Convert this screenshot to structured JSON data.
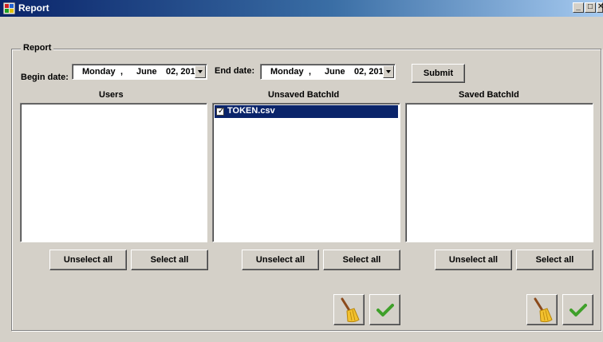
{
  "window": {
    "title": "Report",
    "minimize_glyph": "_",
    "restore_glyph": "□",
    "close_glyph": "✕"
  },
  "group": {
    "title": "Report"
  },
  "filters": {
    "begin_label": "Begin date:",
    "begin": {
      "day": "Monday",
      "sep": ",",
      "month": "June",
      "date": "02, 201"
    },
    "end_label": "End date:",
    "end": {
      "day": "Monday",
      "sep": ",",
      "month": "June",
      "date": "02, 201"
    },
    "submit_label": "Submit"
  },
  "panels": {
    "users": {
      "title": "Users",
      "unselect": "Unselect all",
      "select": "Select all"
    },
    "unsaved": {
      "title": "Unsaved BatchId",
      "unselect": "Unselect all",
      "select": "Select all",
      "items": [
        {
          "text": "TOKEN.csv",
          "checked": true
        }
      ]
    },
    "saved": {
      "title": "Saved BatchId",
      "unselect": "Unselect all",
      "select": "Select all"
    }
  },
  "icons": {
    "clear": "broom-icon",
    "confirm": "checkmark-icon"
  }
}
